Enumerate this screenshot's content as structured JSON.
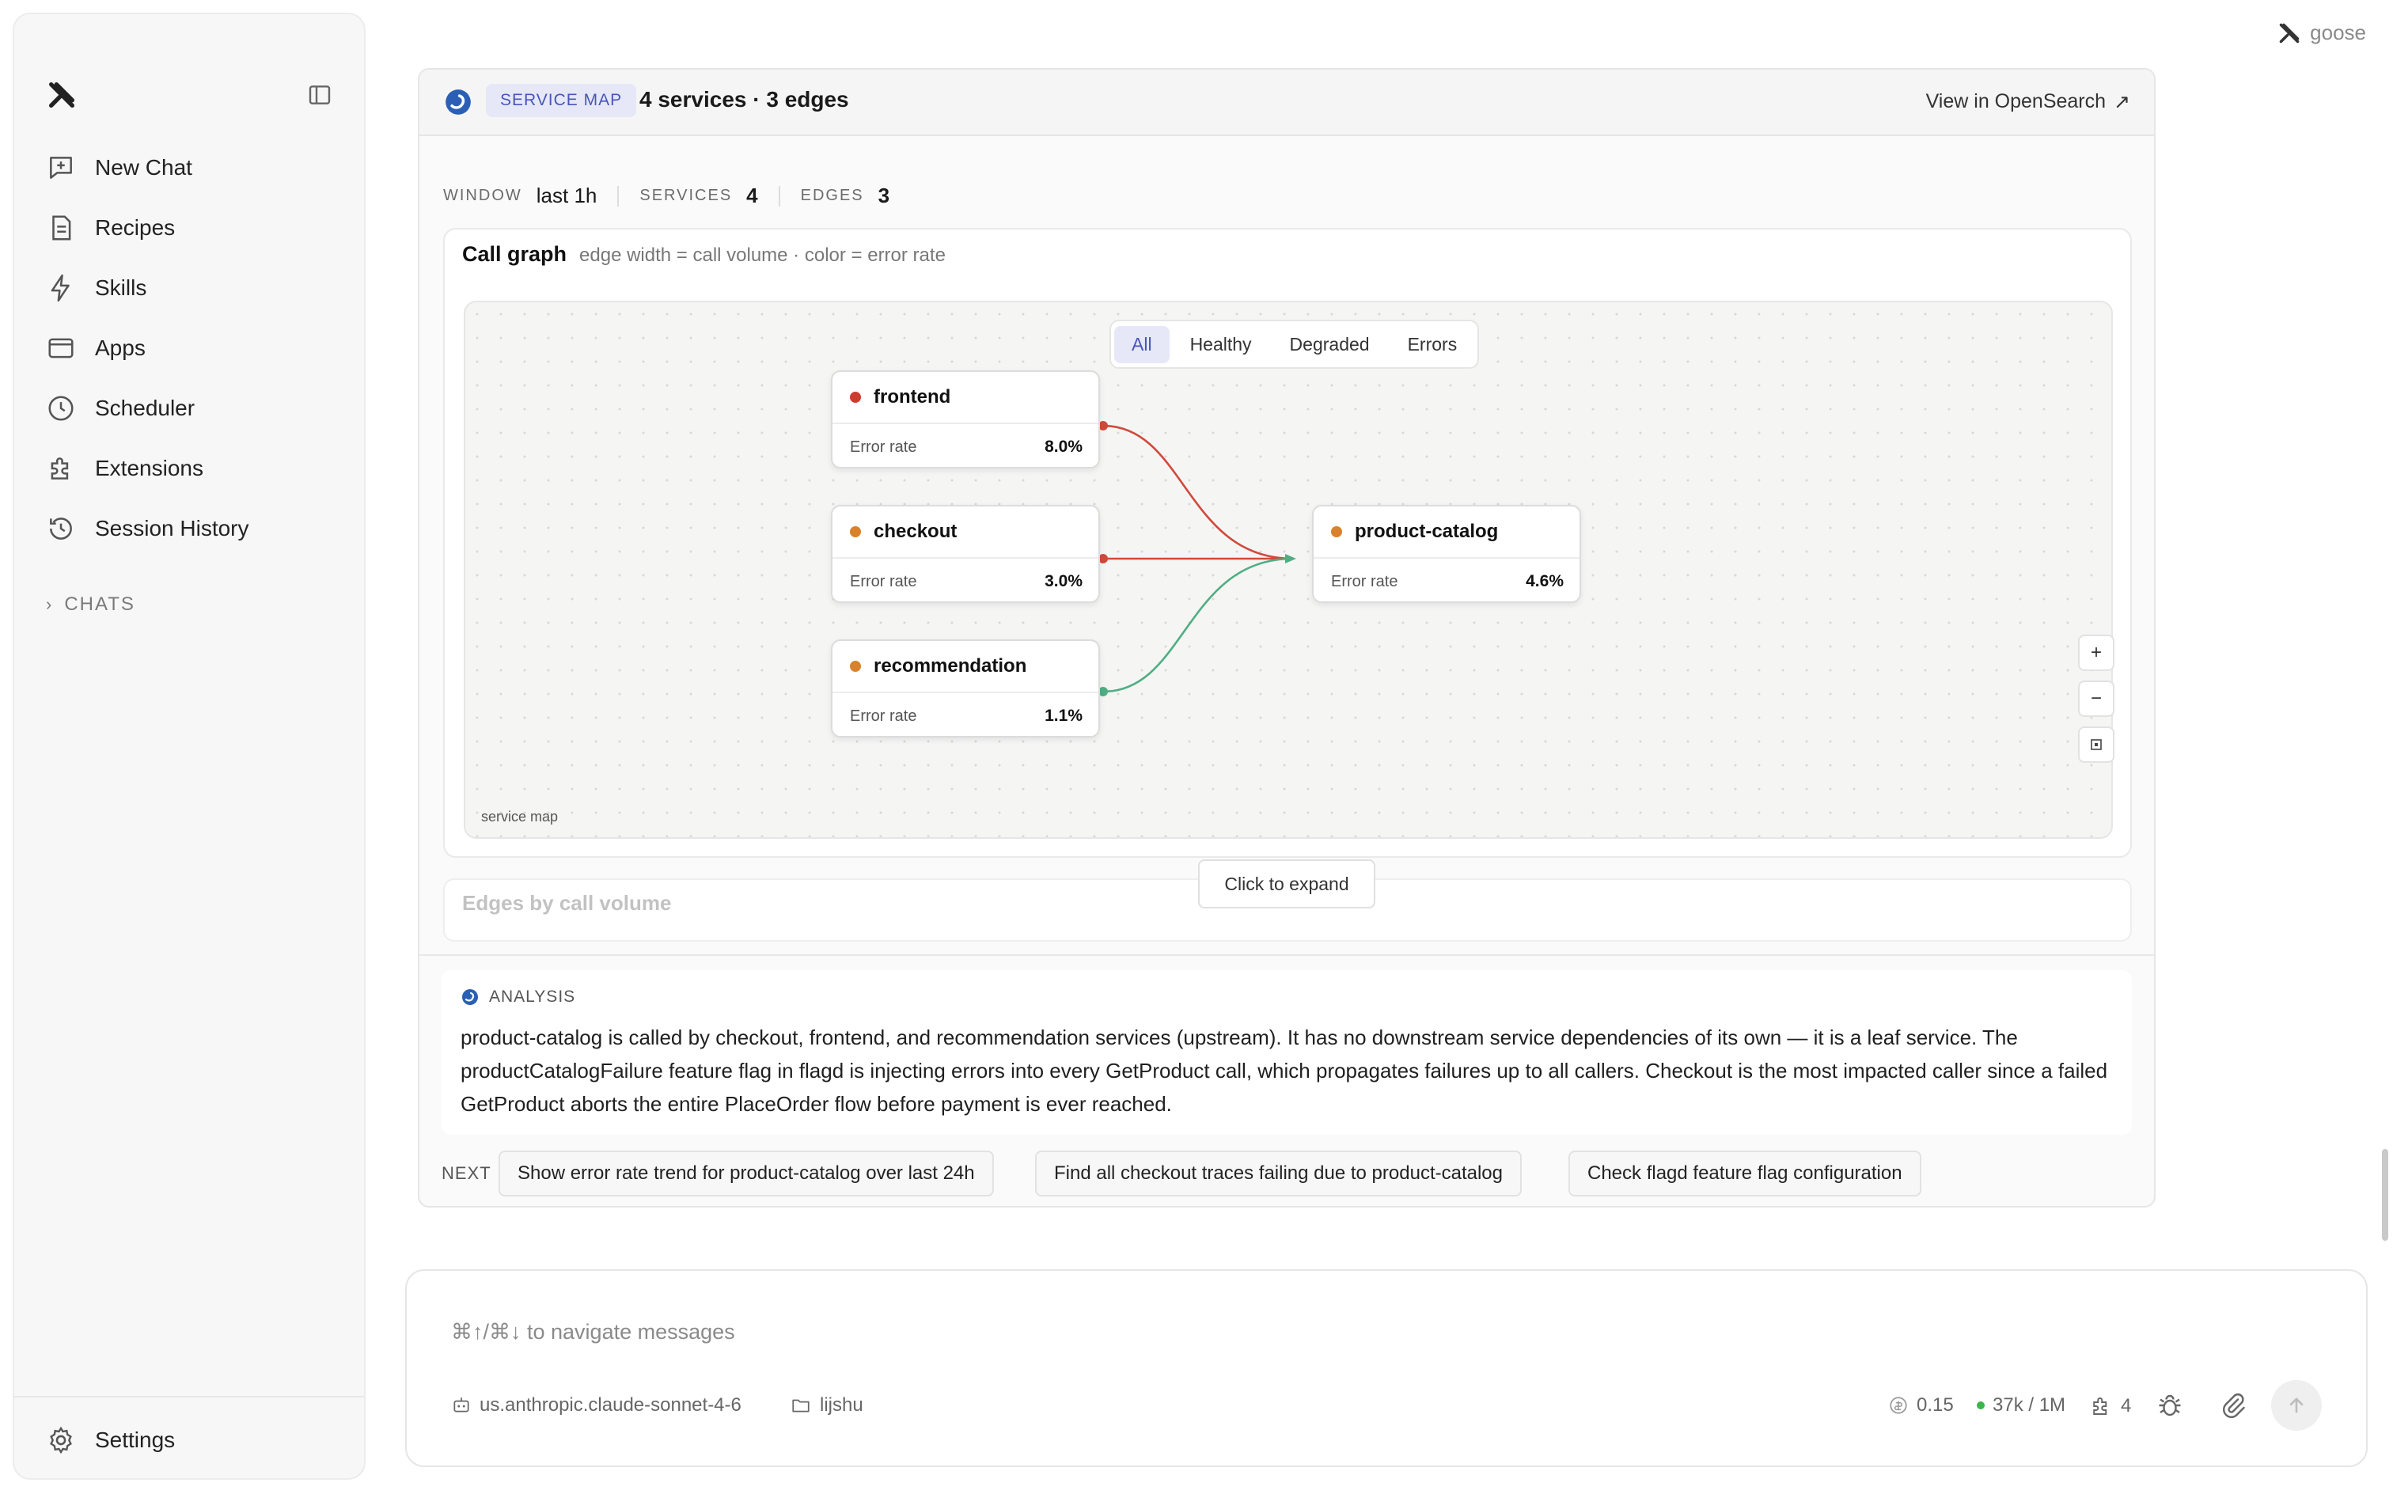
{
  "window": {
    "app_name": "goose"
  },
  "sidebar": {
    "items": [
      {
        "label": "New Chat",
        "icon": "new-chat-icon"
      },
      {
        "label": "Recipes",
        "icon": "recipes-icon"
      },
      {
        "label": "Skills",
        "icon": "bolt-icon"
      },
      {
        "label": "Apps",
        "icon": "apps-icon"
      },
      {
        "label": "Scheduler",
        "icon": "clock-icon"
      },
      {
        "label": "Extensions",
        "icon": "puzzle-icon"
      },
      {
        "label": "Session History",
        "icon": "history-icon"
      }
    ],
    "chats_label": "CHATS",
    "settings_label": "Settings"
  },
  "card": {
    "badge": "SERVICE MAP",
    "title": "4 services · 3 edges",
    "view_link": "View in OpenSearch",
    "stats": [
      {
        "label": "WINDOW",
        "value": "last 1h"
      },
      {
        "label": "SERVICES",
        "value": "4"
      },
      {
        "label": "EDGES",
        "value": "3"
      }
    ],
    "graph_title": "Call graph",
    "graph_subtitle": "edge width = call volume · color = error rate",
    "filters": [
      "All",
      "Healthy",
      "Degraded",
      "Errors"
    ],
    "active_filter": "All",
    "nodes": [
      {
        "name": "frontend",
        "error_label": "Error rate",
        "error_rate": "8.0%",
        "status_color": "#d03b2f"
      },
      {
        "name": "checkout",
        "error_label": "Error rate",
        "error_rate": "3.0%",
        "status_color": "#d9822b"
      },
      {
        "name": "recommendation",
        "error_label": "Error rate",
        "error_rate": "1.1%",
        "status_color": "#d9822b"
      },
      {
        "name": "product-catalog",
        "error_label": "Error rate",
        "error_rate": "4.6%",
        "status_color": "#d9822b"
      }
    ],
    "edge_colors": {
      "error": "#d04a3c",
      "healthy": "#4fae83"
    },
    "zoom_in": "+",
    "zoom_out": "−",
    "canvas_caption": "service map",
    "edges_section_title": "Edges by call volume",
    "expand_label": "Click to expand"
  },
  "analysis": {
    "label": "ANALYSIS",
    "text": "product-catalog is called by checkout, frontend, and recommendation services (upstream). It has no downstream service dependencies of its own — it is a leaf service. The productCatalogFailure feature flag in flagd is injecting errors into every GetProduct call, which propagates failures up to all callers. Checkout is the most impacted caller since a failed GetProduct aborts the entire PlaceOrder flow before payment is ever reached."
  },
  "next": {
    "label": "NEXT",
    "suggestions": [
      "Show error rate trend for product-catalog over last 24h",
      "Find all checkout traces failing due to product-catalog",
      "Check flagd feature flag configuration"
    ]
  },
  "composer": {
    "placeholder": "⌘↑/⌘↓ to navigate messages",
    "model": "us.anthropic.claude-sonnet-4-6",
    "folder": "lijshu",
    "cost": "0.15",
    "context": "37k / 1M",
    "extensions_count": "4"
  },
  "colors": {
    "accent": "#4955b8",
    "accent_bg": "#e6e8f8"
  }
}
